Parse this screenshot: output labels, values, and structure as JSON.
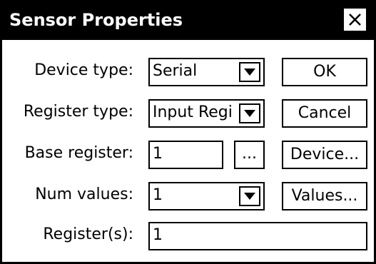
{
  "window": {
    "title": "Sensor Properties",
    "close_icon": "close-icon"
  },
  "fields": {
    "device_type": {
      "label": "Device type:",
      "value": "Serial"
    },
    "register_type": {
      "label": "Register type:",
      "value": "Input Regi"
    },
    "base_register": {
      "label": "Base register:",
      "value": "1",
      "browse_label": "..."
    },
    "num_values": {
      "label": "Num values:",
      "value": "1"
    },
    "registers": {
      "label": "Register(s):",
      "value": "1"
    }
  },
  "buttons": {
    "ok": "OK",
    "cancel": "Cancel",
    "device": "Device...",
    "values": "Values..."
  },
  "icons": {
    "dropdown": "chevron-down-icon"
  },
  "colors": {
    "titlebar": "#000000",
    "title_text": "#ffffff",
    "background": "#ffffff"
  }
}
